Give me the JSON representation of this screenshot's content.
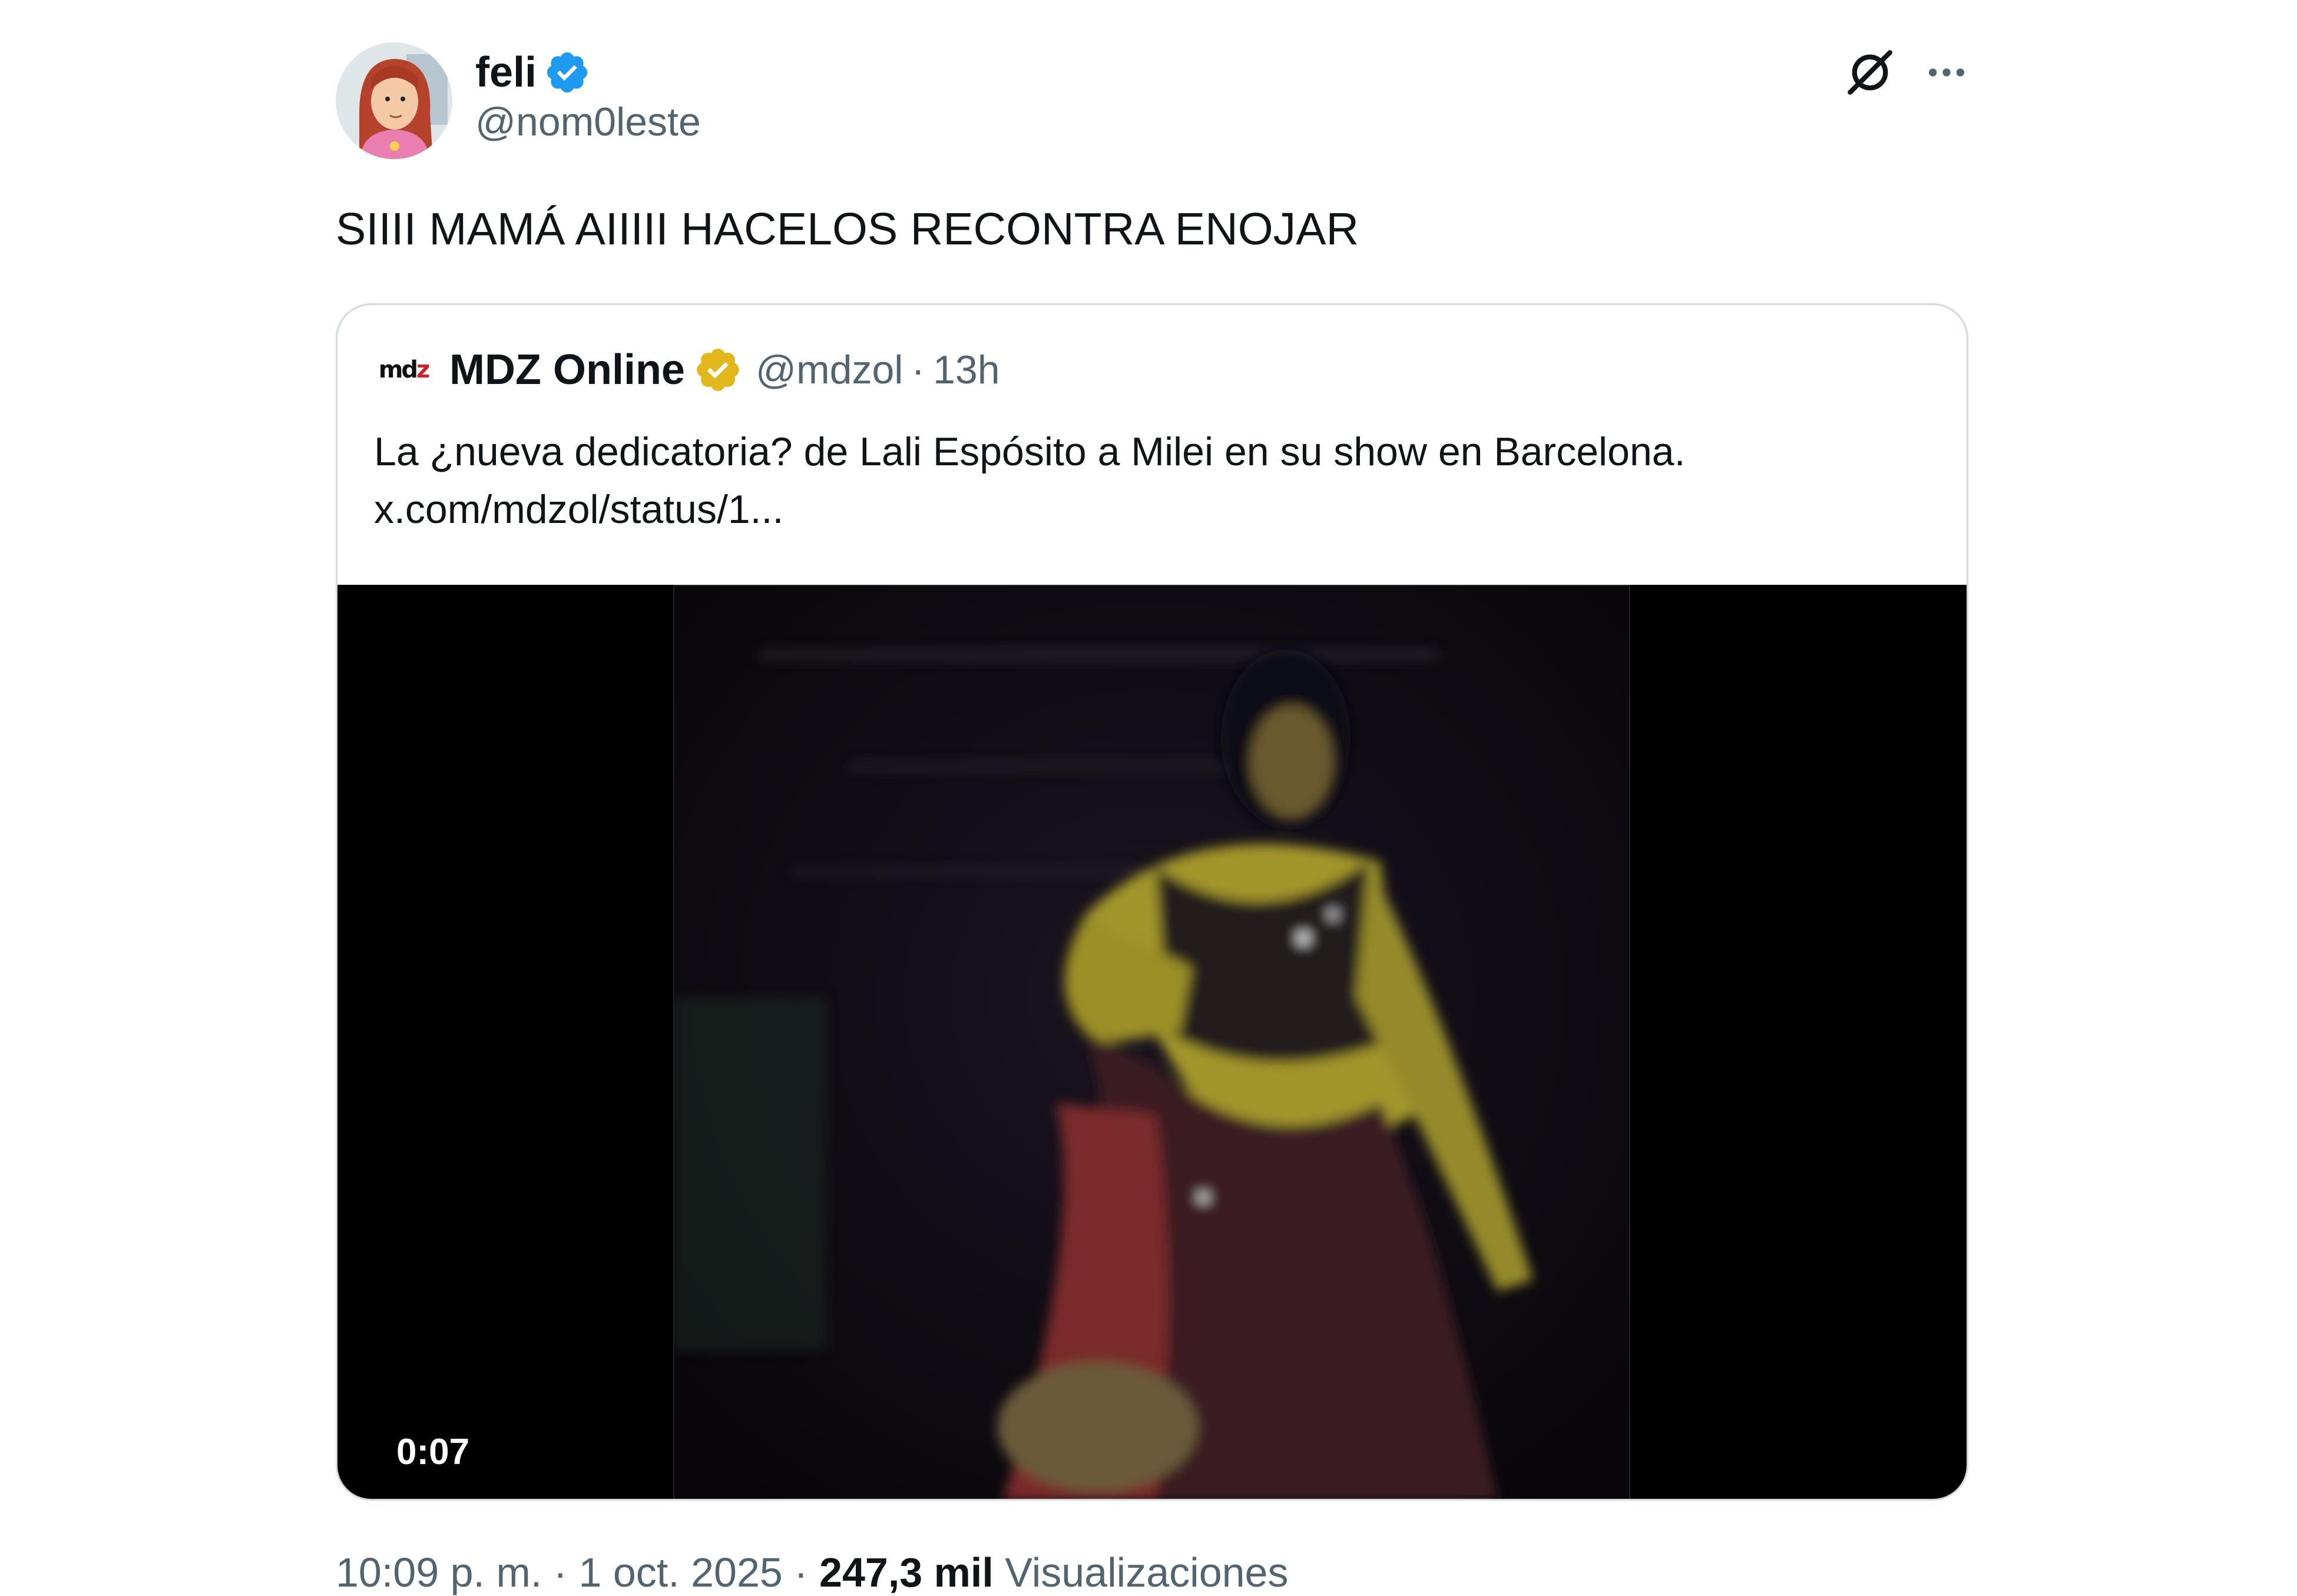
{
  "author": {
    "name": "feli",
    "handle": "@nom0leste",
    "verified": true,
    "avatar_icon": "cartoon-girl-avatar"
  },
  "header_actions": {
    "grok_icon": "grok-icon",
    "more_icon": "more-options-icon"
  },
  "tweet": {
    "text": "SIIII MAMÁ AIIIII HACELOS RECONTRA ENOJAR"
  },
  "quote": {
    "avatar_text_a": "md",
    "avatar_text_b": "z",
    "name": "MDZ Online",
    "verified": "gold",
    "handle": "@mdzol",
    "separator": "·",
    "time": "13h",
    "text_line1": "La ¿nueva dedicatoria? de Lali Espósito a Milei en su show en Barcelona.",
    "text_line2": "x.com/mdzol/status/1...",
    "video_duration": "0:07"
  },
  "meta": {
    "time": "10:09 p. m.",
    "date": "1 oct. 2025",
    "separator": "·",
    "views_count": "247,3 mil",
    "views_label": "Visualizaciones"
  },
  "colors": {
    "primary_text": "#0f1419",
    "secondary_text": "#536471",
    "verified_blue": "#1d9bf0",
    "verified_gold": "#e2b719",
    "border": "#cfd9de"
  }
}
